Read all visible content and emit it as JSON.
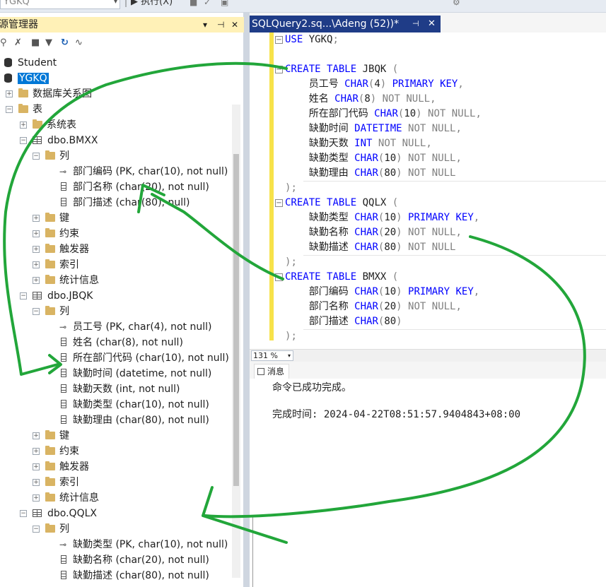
{
  "toolbar": {
    "db_combo": "YGKQ",
    "execute_label": "执行(X)"
  },
  "object_explorer": {
    "title": "源管理器",
    "pin_glyph": "▾ ⊣ ✕",
    "tree": [
      {
        "label": "Student",
        "kind": "database"
      },
      {
        "label": "YGKQ",
        "kind": "database",
        "selected": true
      },
      {
        "label": "数据库关系图",
        "kind": "folder"
      },
      {
        "label": "表",
        "kind": "folder"
      },
      {
        "label": "系统表",
        "kind": "folder"
      },
      {
        "label": "dbo.BMXX",
        "kind": "table"
      },
      {
        "label": "列",
        "kind": "folder"
      },
      {
        "label": "部门编码 (PK, char(10), not null)",
        "kind": "key"
      },
      {
        "label": "部门名称 (char(20), not null)",
        "kind": "column"
      },
      {
        "label": "部门描述 (char(80), null)",
        "kind": "column"
      },
      {
        "label": "键",
        "kind": "folder"
      },
      {
        "label": "约束",
        "kind": "folder"
      },
      {
        "label": "触发器",
        "kind": "folder"
      },
      {
        "label": "索引",
        "kind": "folder"
      },
      {
        "label": "统计信息",
        "kind": "folder"
      },
      {
        "label": "dbo.JBQK",
        "kind": "table"
      },
      {
        "label": "列",
        "kind": "folder"
      },
      {
        "label": "员工号 (PK, char(4), not null)",
        "kind": "key"
      },
      {
        "label": "姓名 (char(8), not null)",
        "kind": "column"
      },
      {
        "label": "所在部门代码 (char(10), not null)",
        "kind": "column"
      },
      {
        "label": "缺勤时间 (datetime, not null)",
        "kind": "column"
      },
      {
        "label": "缺勤天数 (int, not null)",
        "kind": "column"
      },
      {
        "label": "缺勤类型 (char(10), not null)",
        "kind": "column"
      },
      {
        "label": "缺勤理由 (char(80), not null)",
        "kind": "column"
      },
      {
        "label": "键",
        "kind": "folder"
      },
      {
        "label": "约束",
        "kind": "folder"
      },
      {
        "label": "触发器",
        "kind": "folder"
      },
      {
        "label": "索引",
        "kind": "folder"
      },
      {
        "label": "统计信息",
        "kind": "folder"
      },
      {
        "label": "dbo.QQLX",
        "kind": "table"
      },
      {
        "label": "列",
        "kind": "folder"
      },
      {
        "label": "缺勤类型 (PK, char(10), not null)",
        "kind": "key"
      },
      {
        "label": "缺勤名称 (char(20), not null)",
        "kind": "column"
      },
      {
        "label": "缺勤描述 (char(80), not null)",
        "kind": "column"
      }
    ]
  },
  "editor": {
    "tab_title": "SQLQuery2.sq...\\Adeng (52))*",
    "tab_pin": "⊣",
    "tab_close": "✕",
    "code_lines": [
      "USE YGKQ;",
      "",
      "CREATE TABLE JBQK (",
      "    员工号 CHAR(4) PRIMARY KEY,",
      "    姓名 CHAR(8) NOT NULL,",
      "    所在部门代码 CHAR(10) NOT NULL,",
      "    缺勤时间 DATETIME NOT NULL,",
      "    缺勤天数 INT NOT NULL,",
      "    缺勤类型 CHAR(10) NOT NULL,",
      "    缺勤理由 CHAR(80) NOT NULL",
      ");",
      "CREATE TABLE QQLX (",
      "    缺勤类型 CHAR(10) PRIMARY KEY,",
      "    缺勤名称 CHAR(20) NOT NULL,",
      "    缺勤描述 CHAR(80) NOT NULL",
      ");",
      "CREATE TABLE BMXX (",
      "    部门编码 CHAR(10) PRIMARY KEY,",
      "    部门名称 CHAR(20) NOT NULL,",
      "    部门描述 CHAR(80)",
      ");"
    ],
    "zoom": "131 %"
  },
  "messages": {
    "tab_label": "消息",
    "line1": "命令已成功完成。",
    "line2": "完成时间: 2024-04-22T08:51:57.9404843+08:00"
  },
  "colors": {
    "accent": "#0078d7",
    "tab_active": "#1f3c87",
    "keyword": "#0000ff",
    "annotation": "#22a63a",
    "panel_title": "#fff1b7"
  }
}
